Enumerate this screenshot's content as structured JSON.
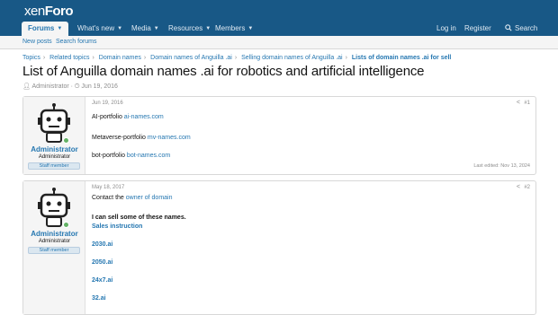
{
  "header": {
    "logo_a": "xen",
    "logo_b": "Foro"
  },
  "nav": {
    "tabs": [
      {
        "label": "Forums"
      },
      {
        "label": "What's new"
      },
      {
        "label": "Media"
      },
      {
        "label": "Resources"
      },
      {
        "label": "Members"
      }
    ],
    "login": "Log in",
    "register": "Register",
    "search": "Search"
  },
  "subnav": {
    "new_posts": "New posts",
    "search_forums": "Search forums"
  },
  "breadcrumb": [
    "Topics",
    "Related topics",
    "Domain names",
    "Domain names of Anguilla .ai",
    "Selling domain names of Anguilla .ai",
    "Lists of domain names .ai for sell"
  ],
  "thread": {
    "title": "List of Anguilla domain names .ai for robotics and artificial intelligence",
    "author": "Administrator",
    "date": "Jun 19, 2016"
  },
  "posts": [
    {
      "user": "Administrator",
      "user_title": "Administrator",
      "badge": "Staff member",
      "date": "Jun 19, 2016",
      "number": "#1",
      "lines": [
        {
          "text": "AI-portfolio ",
          "link": "ai-names.com"
        },
        {
          "text": "Metaverse-portfolio ",
          "link": "mv-names.com"
        },
        {
          "text": "bot-portfolio ",
          "link": "bot-names.com"
        }
      ],
      "edited": "Last edited: Nov 13, 2024"
    },
    {
      "user": "Administrator",
      "user_title": "Administrator",
      "badge": "Staff member",
      "date": "May 18, 2017",
      "number": "#2",
      "contact_text": "Contact the ",
      "contact_link": "owner of domain",
      "sell_text": "I can sell some of these names.",
      "sales_link": "Sales instruction",
      "domains": [
        "2030.ai",
        "2050.ai",
        "24x7.ai",
        "32.ai"
      ]
    }
  ]
}
